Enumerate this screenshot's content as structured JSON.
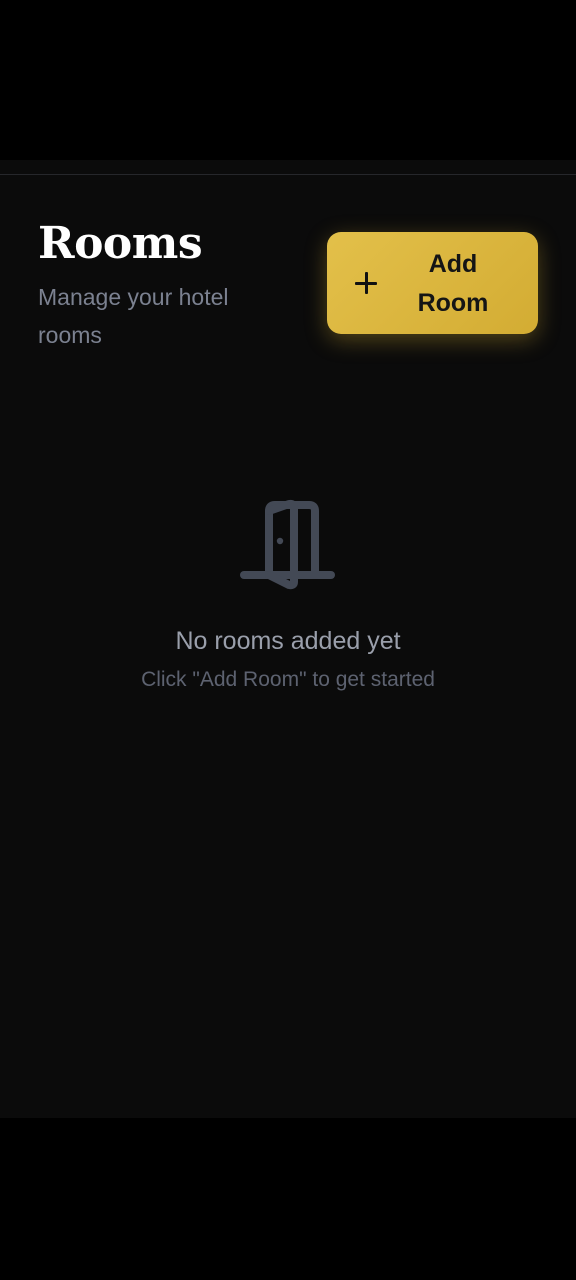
{
  "page": {
    "title": "Rooms",
    "subtitle": "Manage your hotel rooms"
  },
  "actions": {
    "add_room_label": "Add Room",
    "add_room_icon": "plus-icon"
  },
  "empty_state": {
    "icon": "door-icon",
    "title": "No rooms added yet",
    "hint": "Click \"Add Room\" to get started"
  },
  "colors": {
    "accent": "#DDB83E",
    "background": "#0B0B0B",
    "muted_text": "#7B8190"
  }
}
